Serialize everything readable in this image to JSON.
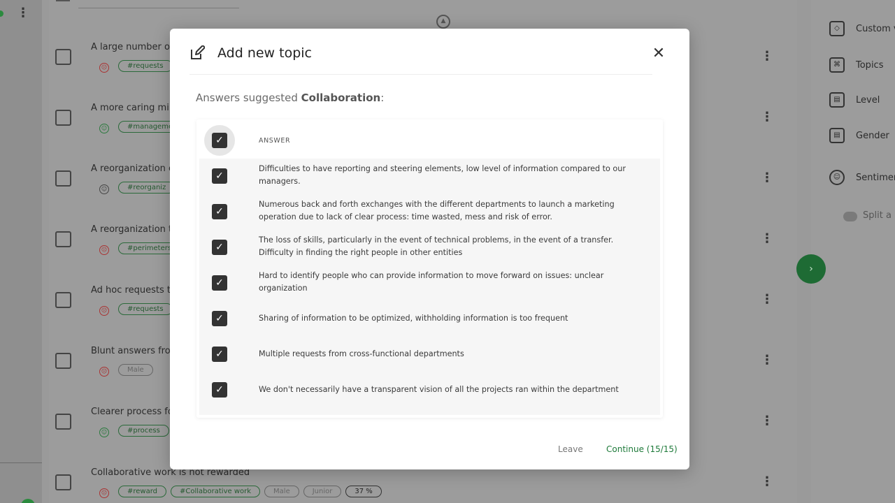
{
  "list": {
    "rows": [
      {
        "title": "A large number o",
        "sentiment": "neg",
        "tags": [
          "#requests"
        ]
      },
      {
        "title": "A more caring mi",
        "sentiment": "pos",
        "tags": [
          "#manageme"
        ]
      },
      {
        "title": "A reorganization c",
        "sentiment": "neu",
        "tags": [
          "#reorganiz"
        ]
      },
      {
        "title": "A reorganization t",
        "sentiment": "neg",
        "tags": [
          "#perimeters"
        ]
      },
      {
        "title": "Ad hoc requests t",
        "sentiment": "neg",
        "tags": [
          "#requests"
        ]
      },
      {
        "title": "Blunt answers fro",
        "sentiment": "neg",
        "tags": [
          "Male"
        ]
      },
      {
        "title": "Clearer process fo",
        "sentiment": "pos",
        "tags": [
          "#process"
        ]
      },
      {
        "title": "Collaborative work is not rewarded",
        "sentiment": "neg",
        "tags": [
          "#reward",
          "#Collaborative work",
          "Male",
          "Junior",
          "37 %"
        ]
      }
    ]
  },
  "right_panel": {
    "items": [
      {
        "label": "Custom v",
        "icon": "tag-icon"
      },
      {
        "label": "Topics",
        "icon": "topics-icon"
      },
      {
        "label": "Level",
        "icon": "level-icon"
      },
      {
        "label": "Gender",
        "icon": "gender-icon"
      },
      {
        "label": "Sentimen",
        "icon": "smiley-icon"
      }
    ],
    "split_label": "Split a"
  },
  "modal": {
    "title": "Add new topic",
    "subtitle_prefix": "Answers suggested ",
    "subtitle_topic": "Collaboration",
    "subtitle_suffix": ":",
    "column_header": "ANSWER",
    "answers": [
      "Difficulties to have reporting and steering elements, low level of information compared to our managers.",
      "Numerous back and forth exchanges with the different departments to launch a marketing operation due to lack of clear process: time wasted, mess and risk of error.",
      "The loss of skills, particularly in the event of technical problems, in the event of a transfer. Difficulty in finding the right people in other entities",
      "Hard to identify people who can provide information to move forward on issues: unclear organization",
      "Sharing of information to be optimized, withholding information is too frequent",
      "Multiple requests from cross-functional departments",
      "We don't necessarily have a transparent vision of all the projects ran within the department"
    ],
    "leave_label": "Leave",
    "continue_label": "Continue (15/15)"
  },
  "colors": {
    "accent_green": "#1e7a3a",
    "checkbox_dark": "#333333"
  }
}
